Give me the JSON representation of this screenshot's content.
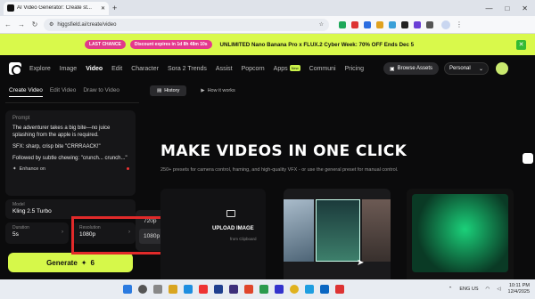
{
  "browser": {
    "tab_title": "AI Video Generator: Create st...",
    "new_tab": "+",
    "url": "higgsfield.ai/create/video",
    "window_controls": [
      "—",
      "□",
      "✕"
    ]
  },
  "promo": {
    "pill1": "LAST CHANCE",
    "pill2": "Discount expires in 1d 8h 48m 10s",
    "text": "UNLIMITED Nano Banana Pro x FLUX.2 Cyber Week: 70% OFF Ends Dec 5"
  },
  "nav": {
    "items": [
      "Explore",
      "Image",
      "Video",
      "Edit",
      "Character",
      "Sora 2 Trends",
      "Assist",
      "Popcorn",
      "Apps",
      "Communi",
      "Pricing"
    ],
    "new_badge": "New",
    "browse_assets": "Browse Assets",
    "workspace": "Personal"
  },
  "left": {
    "tabs": [
      "Create Video",
      "Edit Video",
      "Draw to Video"
    ],
    "prompt_label": "Prompt",
    "prompt_lines": [
      "The adventurer takes a big bite—no juice splashing from the apple is required.",
      "SFX: sharp, crisp bite \"CRRRAACK!\"",
      "Followed by subtle chewing: \"crunch... crunch...\""
    ],
    "enhance": "Enhance on",
    "model_label": "Model",
    "model_value": "Kling 2.5 Turbo",
    "duration_label": "Duration",
    "duration_value": "5s",
    "resolution_label": "Resolution",
    "resolution_value": "1080p",
    "generate": "Generate",
    "generate_cost": "6"
  },
  "dropdown": {
    "options": [
      "720p",
      "1080p"
    ],
    "selected": "1080p"
  },
  "main": {
    "tabs": [
      "History",
      "How it works"
    ],
    "headline": "MAKE VIDEOS IN ONE CLICK",
    "subtitle": "250+ presets for camera control, framing, and high-quality VFX - or use the general preset for manual control.",
    "upload_title": "UPLOAD IMAGE",
    "upload_sub": "from Clipboard"
  },
  "taskbar": {
    "lang": "ENG",
    "region": "US",
    "time": "10:11 PM",
    "date": "12/4/2025"
  },
  "colors": {
    "accent": "#d6f84a",
    "highlight": "#e12a2a",
    "promo_bg": "#d9f94b"
  }
}
